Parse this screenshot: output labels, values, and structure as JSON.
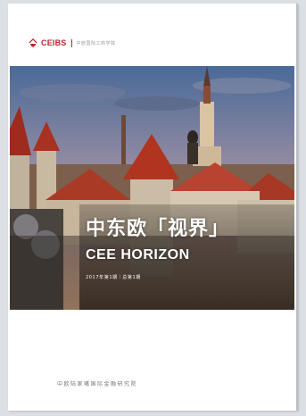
{
  "brand": {
    "name": "CEIBS",
    "subtitle": "中欧国际工商学院",
    "color": "#b3282e"
  },
  "cover": {
    "title_cn": "中东欧「视界」",
    "title_en": "CEE HORIZON",
    "issue": "2017年第1期｜总第1期",
    "publisher": "中欧陆家嘴国际金融研究院"
  }
}
